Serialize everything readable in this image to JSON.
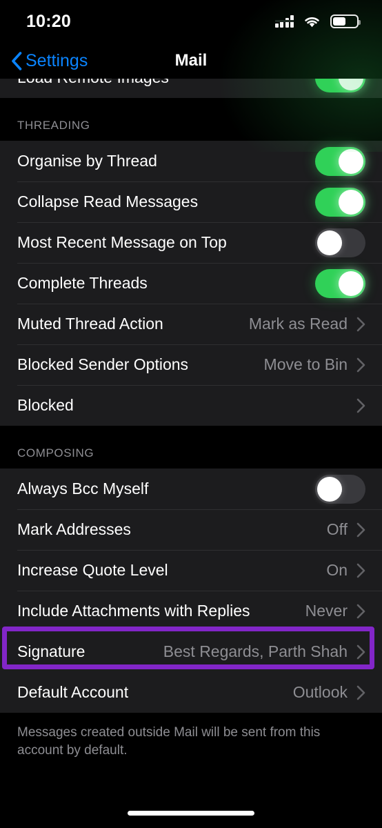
{
  "status_bar": {
    "time": "10:20",
    "cellular_icon": "cellular-bars-icon",
    "wifi_icon": "wifi-icon",
    "battery_icon": "battery-icon",
    "battery_level_percent": 55
  },
  "nav_bar": {
    "back_label": "Settings",
    "back_icon": "chevron-left-icon",
    "title": "Mail"
  },
  "clipped_row": {
    "label": "Load Remote Images",
    "toggle": "on"
  },
  "sections": [
    {
      "header": "THREADING",
      "rows": [
        {
          "label": "Organise by Thread",
          "type": "toggle",
          "toggle": "on"
        },
        {
          "label": "Collapse Read Messages",
          "type": "toggle",
          "toggle": "on"
        },
        {
          "label": "Most Recent Message on Top",
          "type": "toggle",
          "toggle": "off"
        },
        {
          "label": "Complete Threads",
          "type": "toggle",
          "toggle": "on"
        },
        {
          "label": "Muted Thread Action",
          "type": "value",
          "value": "Mark as Read"
        },
        {
          "label": "Blocked Sender Options",
          "type": "value",
          "value": "Move to Bin"
        },
        {
          "label": "Blocked",
          "type": "value",
          "value": ""
        }
      ]
    },
    {
      "header": "COMPOSING",
      "rows": [
        {
          "label": "Always Bcc Myself",
          "type": "toggle",
          "toggle": "off"
        },
        {
          "label": "Mark Addresses",
          "type": "value",
          "value": "Off"
        },
        {
          "label": "Increase Quote Level",
          "type": "value",
          "value": "On"
        },
        {
          "label": "Include Attachments with Replies",
          "type": "value",
          "value": "Never"
        },
        {
          "label": "Signature",
          "type": "value",
          "value": "Best Regards, Parth Shah",
          "highlighted": true
        },
        {
          "label": "Default Account",
          "type": "value",
          "value": "Outlook"
        }
      ]
    }
  ],
  "footer": "Messages created outside Mail will be sent from this account by default.",
  "colors": {
    "accent_blue": "#0A84FF",
    "toggle_on_green": "#30D158",
    "toggle_off_gray": "#39393D",
    "row_background": "#1C1C1E",
    "page_background": "#000000",
    "secondary_text": "#8E8E93",
    "highlight_purple": "#8226C8"
  }
}
